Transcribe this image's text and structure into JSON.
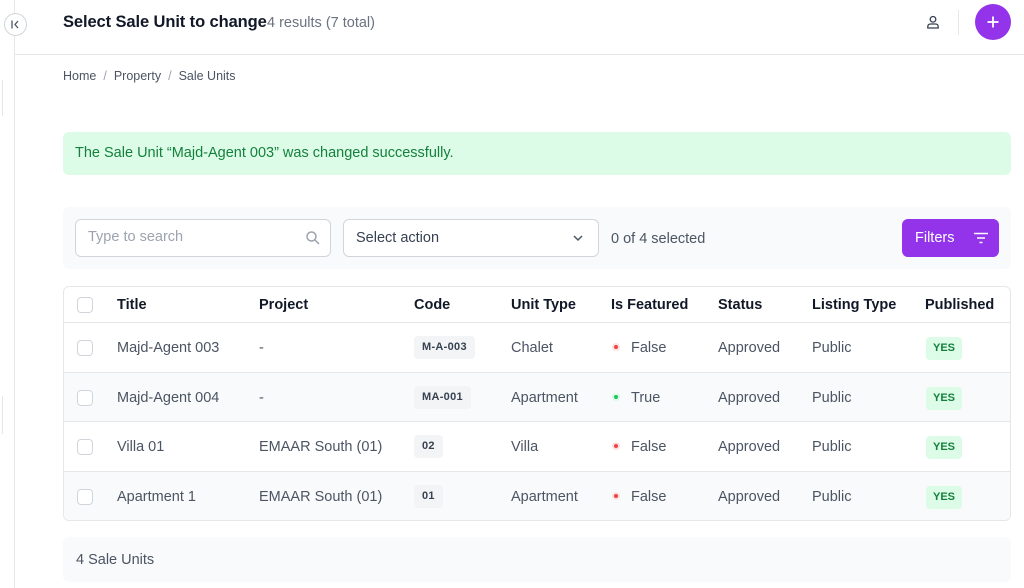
{
  "header": {
    "title": "Select Sale Unit to change",
    "result_count": "4 results (7 total)"
  },
  "breadcrumb": [
    "Home",
    "Property",
    "Sale Units"
  ],
  "alert": {
    "message": "The Sale Unit “Majd-Agent 003” was changed successfully."
  },
  "toolbar": {
    "search_placeholder": "Type to search",
    "action_select": "Select action",
    "selected_count": "0 of 4 selected",
    "filters_label": "Filters"
  },
  "table": {
    "columns": [
      "Title",
      "Project",
      "Code",
      "Unit Type",
      "Is Featured",
      "Status",
      "Listing Type",
      "Published"
    ],
    "rows": [
      {
        "title": "Majd-Agent 003",
        "project": "-",
        "code": "M-A-003",
        "unit_type": "Chalet",
        "featured": "False",
        "status": "Approved",
        "listing_type": "Public",
        "published": "YES"
      },
      {
        "title": "Majd-Agent 004",
        "project": "-",
        "code": "MA-001",
        "unit_type": "Apartment",
        "featured": "True",
        "status": "Approved",
        "listing_type": "Public",
        "published": "YES"
      },
      {
        "title": "Villa 01",
        "project": "EMAAR South (01)",
        "code": "02",
        "unit_type": "Villa",
        "featured": "False",
        "status": "Approved",
        "listing_type": "Public",
        "published": "YES"
      },
      {
        "title": "Apartment 1",
        "project": "EMAAR South (01)",
        "code": "01",
        "unit_type": "Apartment",
        "featured": "False",
        "status": "Approved",
        "listing_type": "Public",
        "published": "YES"
      }
    ]
  },
  "footer": {
    "count_label": "4 Sale Units"
  },
  "colors": {
    "accent": "#9333ea",
    "success_bg": "#dcfce7",
    "success_text": "#15803d",
    "status_true": "#22c55e",
    "status_false": "#ef4444"
  },
  "icons": {
    "collapse": "collapse-sidebar-icon",
    "user": "user-icon",
    "add": "plus-icon",
    "search": "search-icon",
    "chevron": "chevron-down-icon",
    "filters": "filter-lines-icon"
  }
}
